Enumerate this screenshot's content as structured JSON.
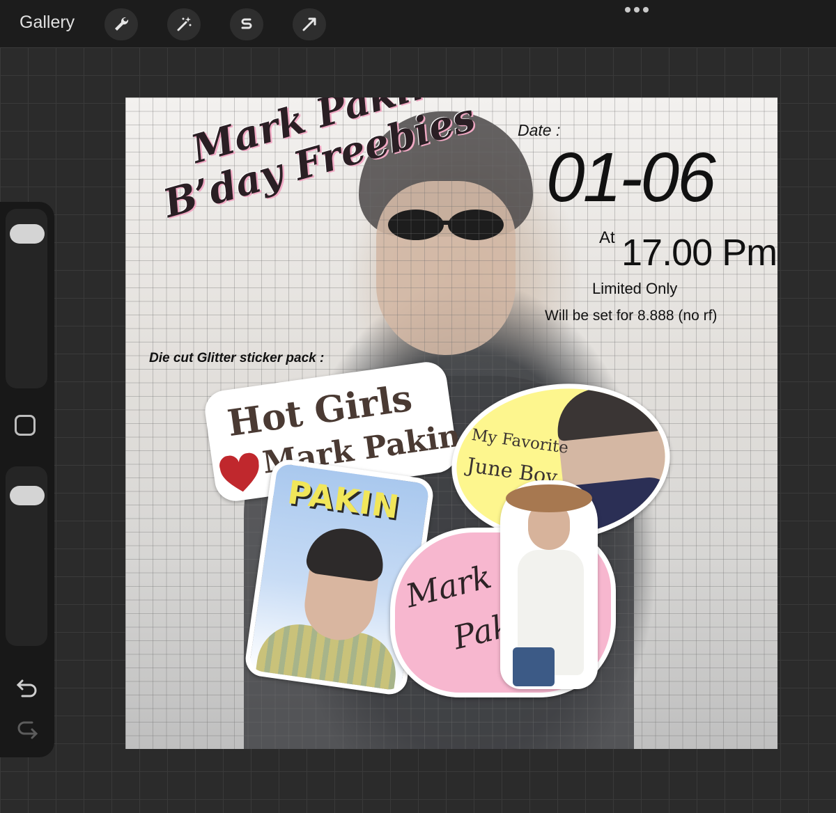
{
  "topbar": {
    "gallery_label": "Gallery",
    "tools": [
      {
        "name": "actions",
        "icon": "wrench-icon"
      },
      {
        "name": "adjustments",
        "icon": "magic-wand-icon"
      },
      {
        "name": "selection",
        "icon": "selection-s-icon"
      },
      {
        "name": "transform",
        "icon": "arrow-cursor-icon"
      }
    ],
    "more_icon": "more-dots-icon"
  },
  "sidebar": {
    "brush_size_icon": "brush-size-slider",
    "modify_icon": "square-modify-icon",
    "opacity_icon": "opacity-slider",
    "undo_icon": "undo-icon",
    "redo_icon": "redo-icon"
  },
  "artwork": {
    "title_line1": "Mark Pakin",
    "title_line2": "B’day Freebies",
    "date_label": "Date :",
    "date_value": "01-06",
    "at_label": "At",
    "time_value": "17.00 Pm",
    "limited_text": "Limited Only",
    "price_text": "Will be set for 8.888 (no rf)",
    "pack_label": "Die cut Glitter sticker pack :",
    "sticker_hotgirls_line1": "Hot Girls",
    "sticker_hotgirls_line2": "Mark Pakin",
    "sticker_june_line1": "My Favorite",
    "sticker_june_line2": "June Boy",
    "sticker_pakin_word": "PAKIN",
    "sticker_markpakin_line1": "Mark",
    "sticker_markpakin_line2": "Pakin",
    "colors": {
      "pink_accent": "#f1a9c4",
      "yellow_sticker": "#fdf68e",
      "pink_sticker": "#f7b7cf",
      "blue_sticker": "#a9c8ee",
      "heart_red": "#c0282d"
    }
  }
}
